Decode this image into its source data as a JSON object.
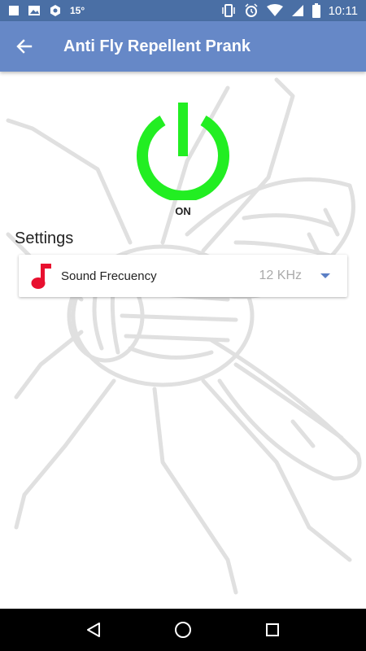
{
  "status_bar": {
    "temperature": "15°",
    "time": "10:11",
    "icons": [
      "square-icon",
      "image-icon",
      "hexagon-icon",
      "vibrate-icon",
      "alarm-icon",
      "wifi-icon",
      "signal-icon",
      "battery-icon"
    ]
  },
  "app_bar": {
    "title": "Anti Fly Repellent Prank",
    "back_icon": "arrow-back-icon"
  },
  "power": {
    "state_label": "ON",
    "color": "#22ee22"
  },
  "settings": {
    "title": "Settings",
    "items": [
      {
        "label": "Sound Frecuency",
        "value": "12 KHz",
        "icon": "music-note-icon",
        "icon_color": "#e8102f"
      }
    ]
  },
  "nav_bar": {
    "buttons": [
      "back-triangle-icon",
      "home-circle-icon",
      "recents-square-icon"
    ]
  },
  "colors": {
    "status_bar": "#4a6fa5",
    "app_bar": "#6688c7",
    "accent": "#5b7fc5"
  }
}
